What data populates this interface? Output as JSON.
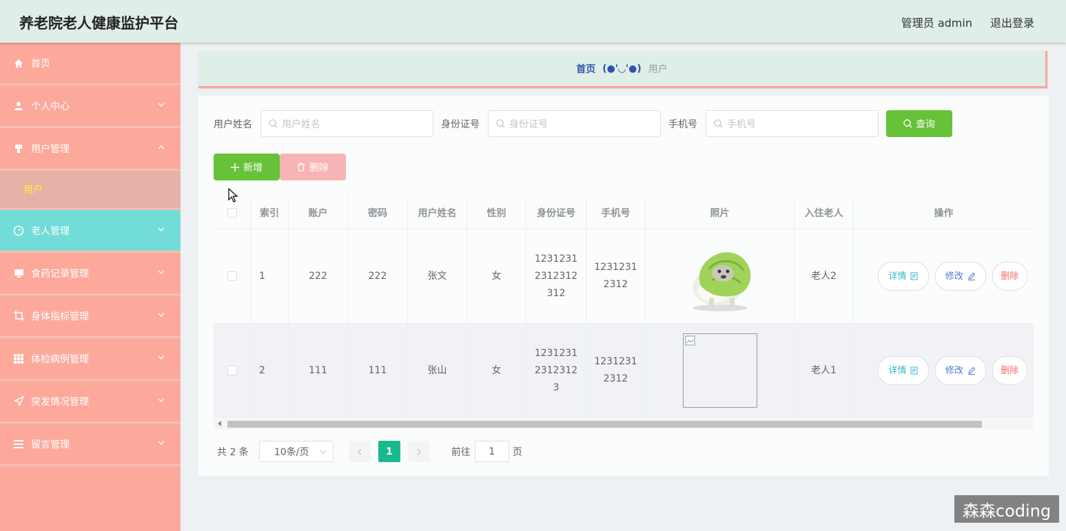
{
  "header": {
    "title": "养老院老人健康监护平台",
    "user": "管理员 admin",
    "logout": "退出登录"
  },
  "sidebar": {
    "items": [
      {
        "label": "首页",
        "icon": "home-icon"
      },
      {
        "label": "个人中心",
        "icon": "user-icon"
      },
      {
        "label": "用户管理",
        "icon": "usermanage-icon"
      },
      {
        "label": "老人管理",
        "icon": "dashboard-icon"
      },
      {
        "label": "食药记录管理",
        "icon": "monitor-icon"
      },
      {
        "label": "身体指标管理",
        "icon": "crop-icon"
      },
      {
        "label": "体检病例管理",
        "icon": "grid-icon"
      },
      {
        "label": "突发情况管理",
        "icon": "send-icon"
      },
      {
        "label": "留言管理",
        "icon": "list-icon"
      }
    ],
    "submenu": {
      "label": "用户"
    }
  },
  "breadcrumb": {
    "home": "首页",
    "separator": "(●'◡'●)",
    "current": "用户"
  },
  "search": {
    "name_label": "用户姓名",
    "name_placeholder": "用户姓名",
    "id_label": "身份证号",
    "id_placeholder": "身份证号",
    "phone_label": "手机号",
    "phone_placeholder": "手机号",
    "query_button": "查询"
  },
  "actions": {
    "add": "新增",
    "delete": "删除"
  },
  "table": {
    "headers": [
      "索引",
      "账户",
      "密码",
      "用户姓名",
      "性别",
      "身份证号",
      "手机号",
      "照片",
      "入住老人",
      "操作"
    ],
    "rows": [
      {
        "index": "1",
        "account": "222",
        "password": "222",
        "name": "张文",
        "gender": "女",
        "id_lines": [
          "1231231",
          "2312312",
          "312"
        ],
        "phone_lines": [
          "1231231",
          "2312"
        ],
        "elder": "老人2"
      },
      {
        "index": "2",
        "account": "111",
        "password": "111",
        "name": "张山",
        "gender": "女",
        "id_lines": [
          "1231231",
          "2312312",
          "3"
        ],
        "phone_lines": [
          "1231231",
          "2312"
        ],
        "elder": "老人1"
      }
    ],
    "op_detail": "详情",
    "op_edit": "修改",
    "op_delete": "删除"
  },
  "pagination": {
    "total": "共 2 条",
    "page_size": "10条/页",
    "current_page": "1",
    "goto_label": "前往",
    "goto_value": "1",
    "page_suffix": "页"
  },
  "watermark": "森森coding",
  "colors": {
    "header_bg": "#dfeee6",
    "sidebar_bg": "#fca99c",
    "sidebar_active": "#72ddd8",
    "submenu_text": "#f7f33c",
    "primary_green": "#67c23a",
    "page_active": "#19b98d",
    "danger": "#f56c6c"
  }
}
